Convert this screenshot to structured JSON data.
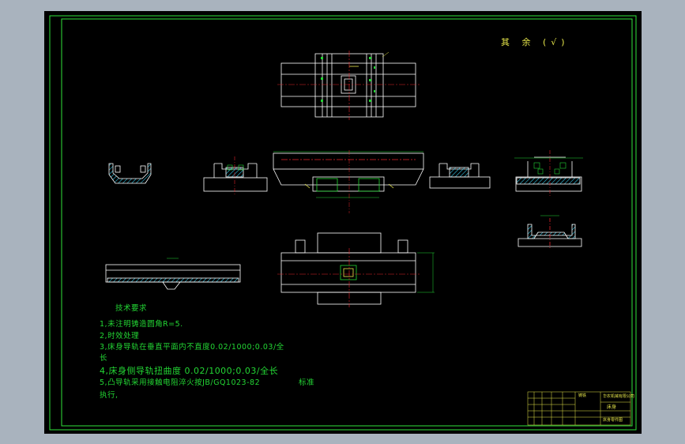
{
  "drawing": {
    "sheet_label": "其 余 (√)",
    "tech_title": "技术要求",
    "notes": [
      "1,未注明铸造圆角R=5.",
      "2,时效处理",
      "3,床身导轨在垂直平面内不直度0.02/1000;0.03/全",
      "长",
      "4,床身侧导轨扭曲度 0.02/1000;0.03/全长",
      "5,凸导轨采用接触电阻淬火按JB/GQ1023-82",
      "标准",
      "执行,"
    ],
    "title_block": {
      "part_name": "床身",
      "company": "华农机械有限公司",
      "drawing_code": "铸铁",
      "drawing_no": "床身零件图"
    }
  },
  "colors": {
    "background": "#000000",
    "frame": "#2fe23a",
    "outline": "#ffffff",
    "centerline": "#e3242b",
    "hatch": "#33c8e8",
    "dimension": "#23d634",
    "annotation": "#e6e64a"
  }
}
